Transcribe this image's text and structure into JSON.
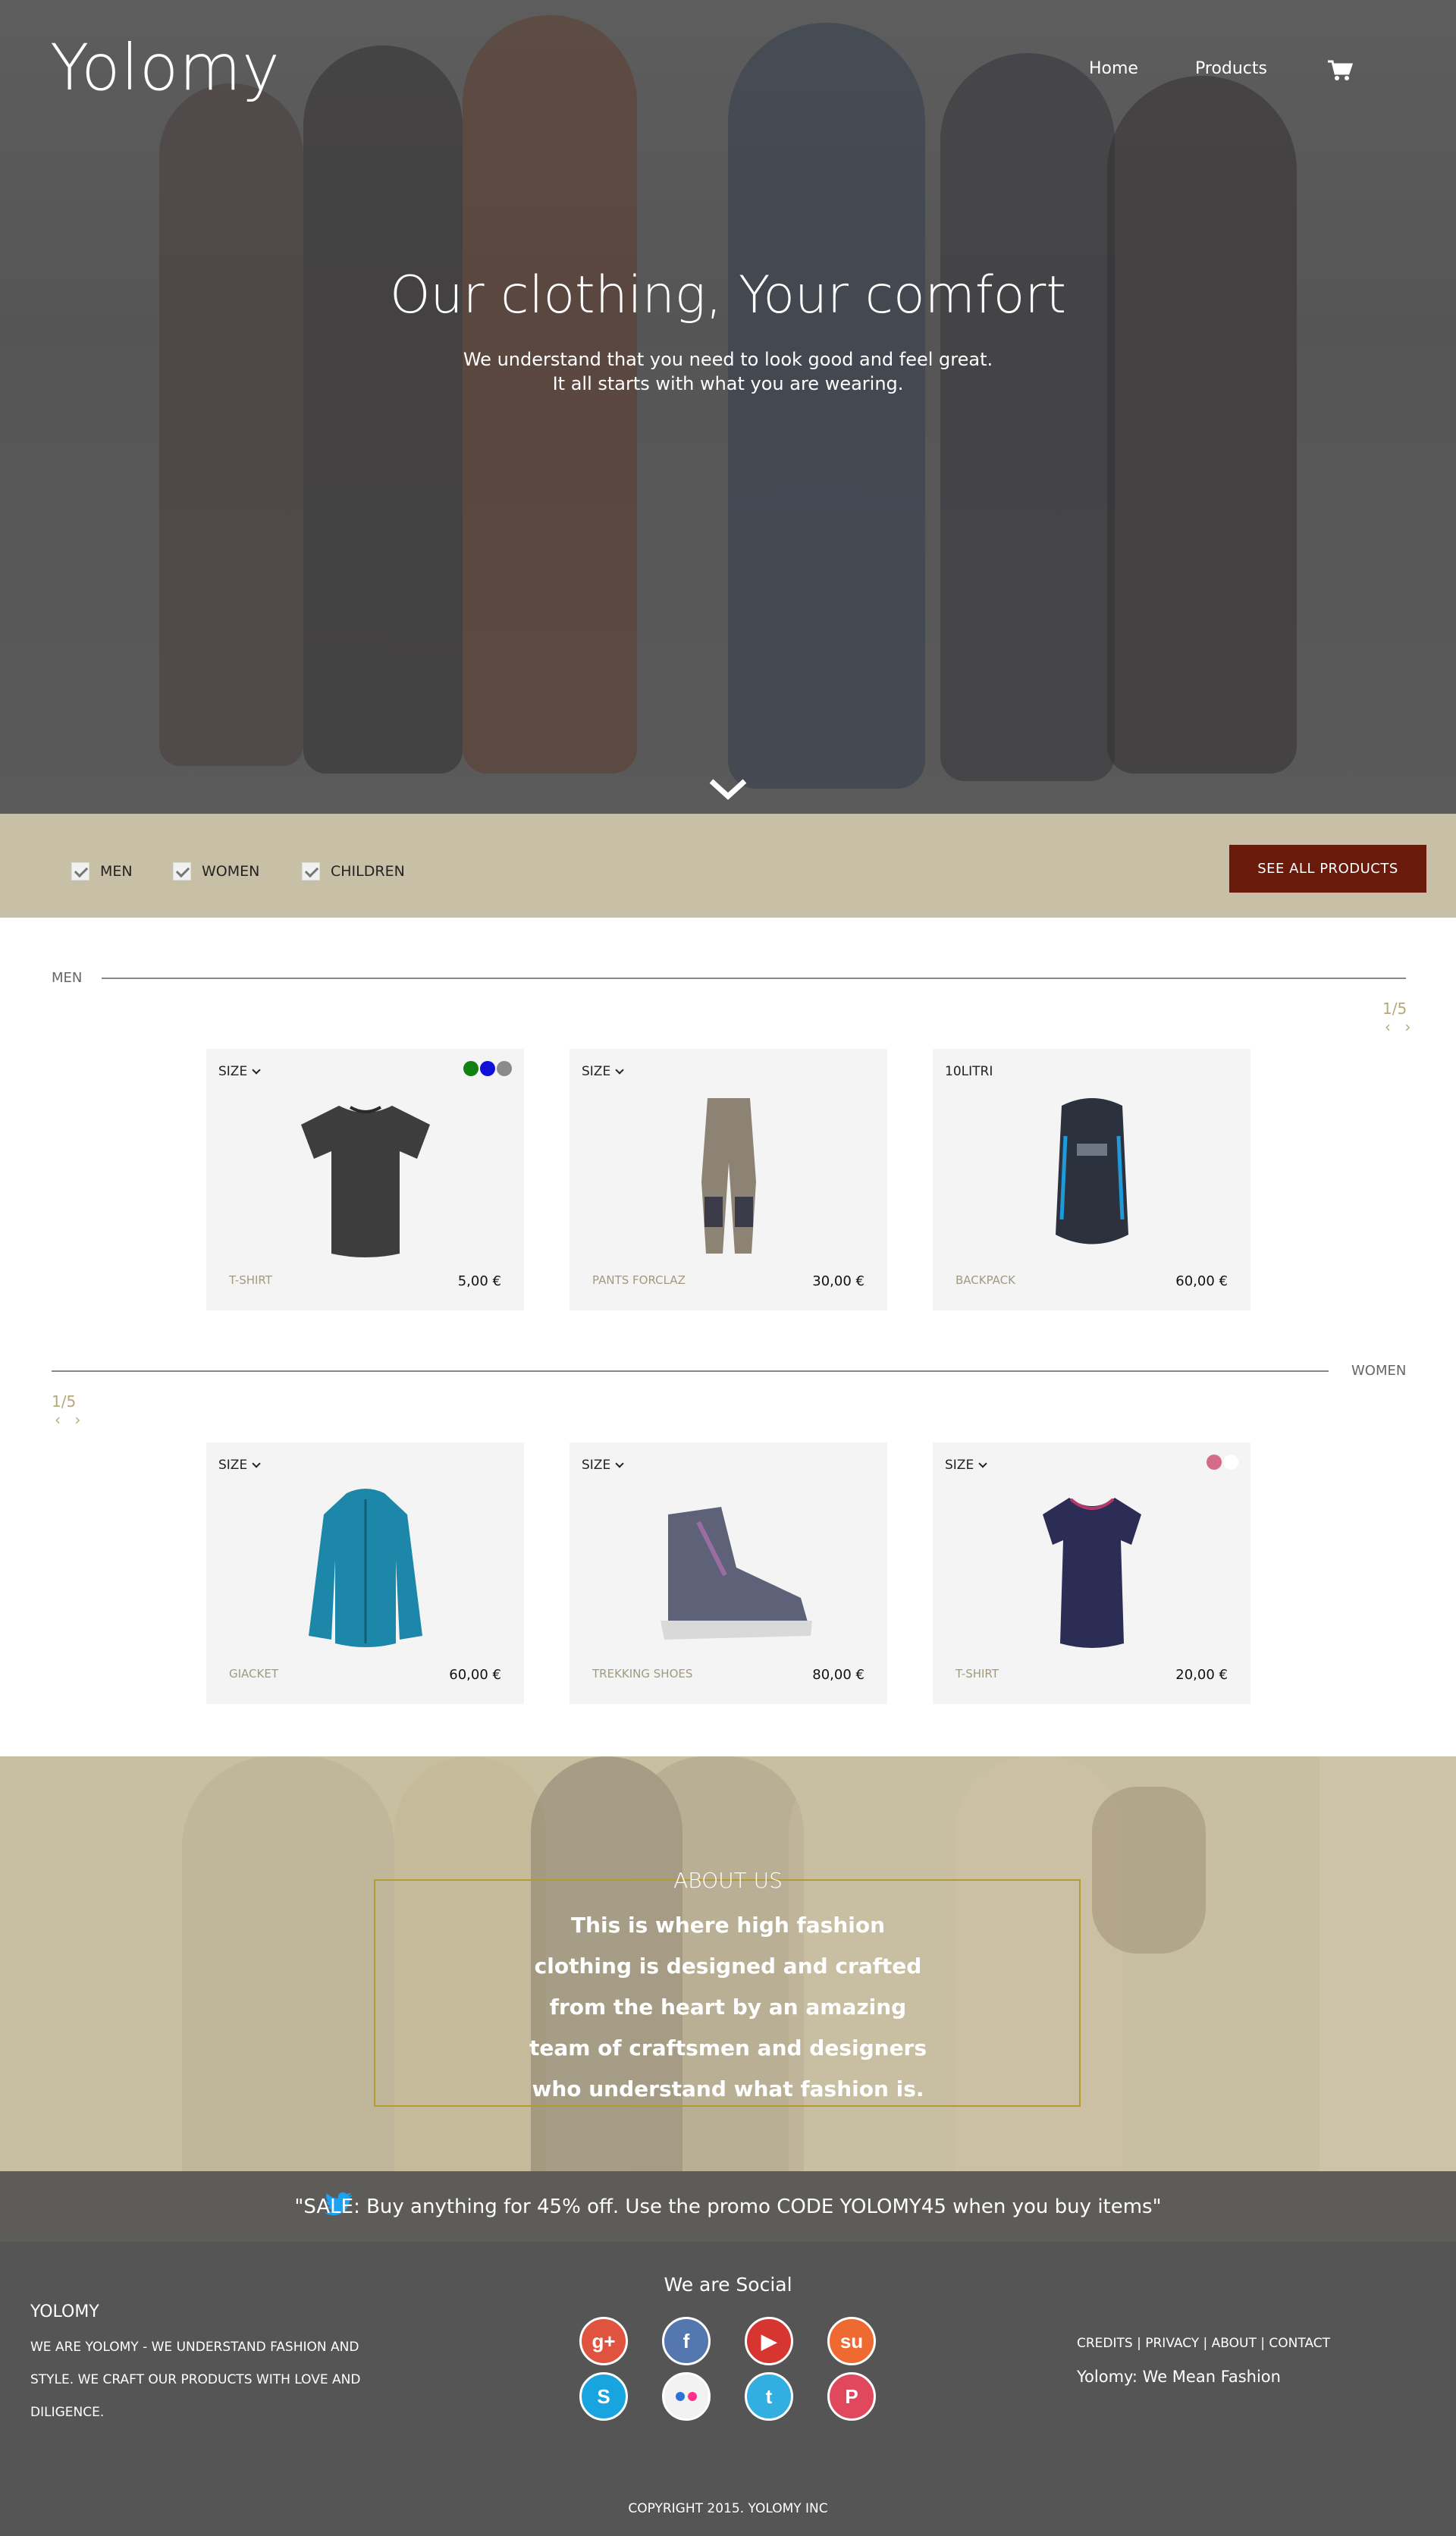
{
  "header": {
    "logo": "Yolomy",
    "nav": [
      {
        "label": "Home"
      },
      {
        "label": "Products"
      }
    ],
    "cart_icon": "shopping-cart-icon"
  },
  "hero": {
    "title": "Our clothing, Your comfort",
    "subtitle_line1": "We understand that you need to look good and feel great.",
    "subtitle_line2": "It all starts with what you are wearing.",
    "scroll_icon": "chevron-down-icon"
  },
  "filters": {
    "options": [
      {
        "label": "MEN",
        "checked": true
      },
      {
        "label": "WOMEN",
        "checked": true
      },
      {
        "label": "CHILDREN",
        "checked": true
      }
    ],
    "see_all": "SEE ALL PRODUCTS"
  },
  "sections": [
    {
      "label": "MEN",
      "pager": "1/5",
      "pager_arrows": "‹ ›",
      "products": [
        {
          "top": "SIZE",
          "has_dropdown": true,
          "name": "T-SHIRT",
          "price": "5,00 €",
          "colors": [
            "#128012",
            "#1010d8",
            "#8a8a8a"
          ],
          "image": "tshirt-dark"
        },
        {
          "top": "SIZE",
          "has_dropdown": true,
          "name": "PANTS FORCLAZ",
          "price": "30,00 €",
          "colors": [],
          "image": "pants"
        },
        {
          "top": "10LITRI",
          "has_dropdown": false,
          "name": "BACKPACK",
          "price": "60,00 €",
          "colors": [],
          "image": "backpack"
        }
      ]
    },
    {
      "label": "WOMEN",
      "pager": "1/5",
      "pager_arrows": "‹ ›",
      "products": [
        {
          "top": "SIZE",
          "has_dropdown": true,
          "name": "GIACKET",
          "price": "60,00 €",
          "colors": [],
          "image": "jacket"
        },
        {
          "top": "SIZE",
          "has_dropdown": true,
          "name": "TREKKING SHOES",
          "price": "80,00 €",
          "colors": [],
          "image": "shoe"
        },
        {
          "top": "SIZE",
          "has_dropdown": true,
          "name": "T-SHIRT",
          "price": "20,00 €",
          "colors": [
            "#d56a8a",
            "#ffffff"
          ],
          "image": "tshirt-navy"
        }
      ]
    }
  ],
  "about": {
    "title": "ABOUT US",
    "text": "This is where high fashion clothing is designed and crafted from the heart by an amazing team of craftsmen and designers who understand what fashion is."
  },
  "promo": {
    "icon": "twitter-bird-icon",
    "text": "\"SALE: Buy anything for 45% off. Use the promo CODE YOLOMY45 when you buy items\""
  },
  "footer": {
    "brand": "YOLOMY",
    "description": "WE ARE YOLOMY - WE UNDERSTAND FASHION AND STYLE. WE CRAFT OUR PRODUCTS WITH LOVE AND DILIGENCE.",
    "social_title": "We are Social",
    "social": [
      {
        "icon": "google-plus-icon",
        "color": "#e0533f",
        "glyph": "g+"
      },
      {
        "icon": "facebook-icon",
        "color": "#5577b0",
        "glyph": "f"
      },
      {
        "icon": "youtube-icon",
        "color": "#d6362f",
        "glyph": "▶"
      },
      {
        "icon": "stumbleupon-icon",
        "color": "#ef6a30",
        "glyph": "su"
      },
      {
        "icon": "skype-icon",
        "color": "#18a4df",
        "glyph": "S"
      },
      {
        "icon": "flickr-icon",
        "color": "#f2f2f2",
        "glyph": ""
      },
      {
        "icon": "twitter-icon",
        "color": "#33aee0",
        "glyph": "t"
      },
      {
        "icon": "pinterest-icon",
        "color": "#e0485e",
        "glyph": "P"
      }
    ],
    "links": "CREDITS | PRIVACY | ABOUT | CONTACT",
    "tagline": "Yolomy: We Mean Fashion",
    "copyright": "COPYRIGHT 2015. YOLOMY INC"
  }
}
